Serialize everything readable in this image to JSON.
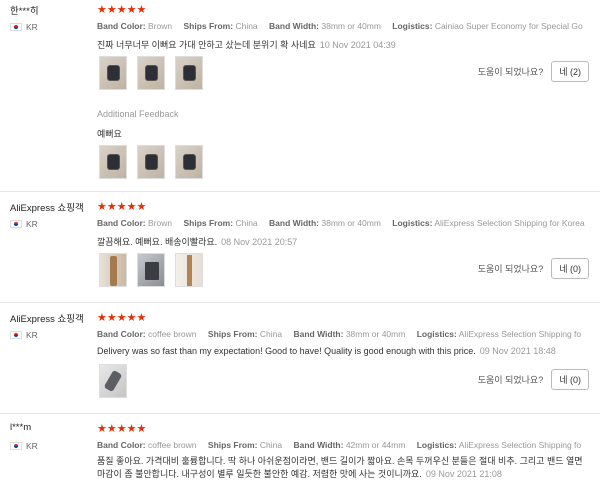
{
  "reviews": [
    {
      "user": "한***히",
      "country": "KR",
      "stars": "★★★★★",
      "attributes": [
        {
          "label": "Band Color:",
          "value": "Brown"
        },
        {
          "label": "Ships From:",
          "value": "China"
        },
        {
          "label": "Band Width:",
          "value": "38mm or 40mm"
        },
        {
          "label": "Logistics:",
          "value": "Cainiao Super Economy for Special Go"
        }
      ],
      "text": "진짜 너무너무 이뻐요 가대 안하고 샀는데 분위기 확 사네요",
      "date": "10 Nov 2021 04:39",
      "helpful_label": "도움이 되었나요?",
      "yes_label": "네 (2)",
      "additional_feedback_label": "Additional Feedback",
      "additional_text": "예뻐요"
    },
    {
      "user": "AliExpress 쇼핑객",
      "country": "KR",
      "stars": "★★★★★",
      "attributes": [
        {
          "label": "Band Color:",
          "value": "Brown"
        },
        {
          "label": "Ships From:",
          "value": "China"
        },
        {
          "label": "Band Width:",
          "value": "38mm or 40mm"
        },
        {
          "label": "Logistics:",
          "value": "AliExpress Selection Shipping for Korea"
        }
      ],
      "text": "깔끔해요. 예뻐요. 배송이빨라요.",
      "date": "08 Nov 2021 20:57",
      "helpful_label": "도움이 되었나요?",
      "yes_label": "네 (0)"
    },
    {
      "user": "AliExpress 쇼핑객",
      "country": "KR",
      "stars": "★★★★★",
      "attributes": [
        {
          "label": "Band Color:",
          "value": "coffee brown"
        },
        {
          "label": "Ships From:",
          "value": "China"
        },
        {
          "label": "Band Width:",
          "value": "38mm or 40mm"
        },
        {
          "label": "Logistics:",
          "value": "AliExpress Selection Shipping fo"
        }
      ],
      "text": "Delivery was so fast than my expectation! Good to have! Quality is good enough with this price.",
      "date": "09 Nov 2021 18:48",
      "helpful_label": "도움이 되었나요?",
      "yes_label": "네 (0)"
    },
    {
      "user": "l***m",
      "country": "KR",
      "stars": "★★★★★",
      "attributes": [
        {
          "label": "Band Color:",
          "value": "coffee brown"
        },
        {
          "label": "Ships From:",
          "value": "China"
        },
        {
          "label": "Band Width:",
          "value": "42mm or 44mm"
        },
        {
          "label": "Logistics:",
          "value": "AliExpress Selection Shipping fo"
        }
      ],
      "text": "품질 좋아요. 가격대비 훌륭합니다. 딱 하나 아쉬운점이라면, 밴드 길이가 짧아요. 손목 두꺼우신 분들은 절대 비추. 그리고 밴드 열면 마감이 좀 불안합니다. 내구성이 별루 일듯한 불안한 예감. 저렴한 맛에 사는 것이니까요.",
      "date": "09 Nov 2021 21:08"
    }
  ]
}
